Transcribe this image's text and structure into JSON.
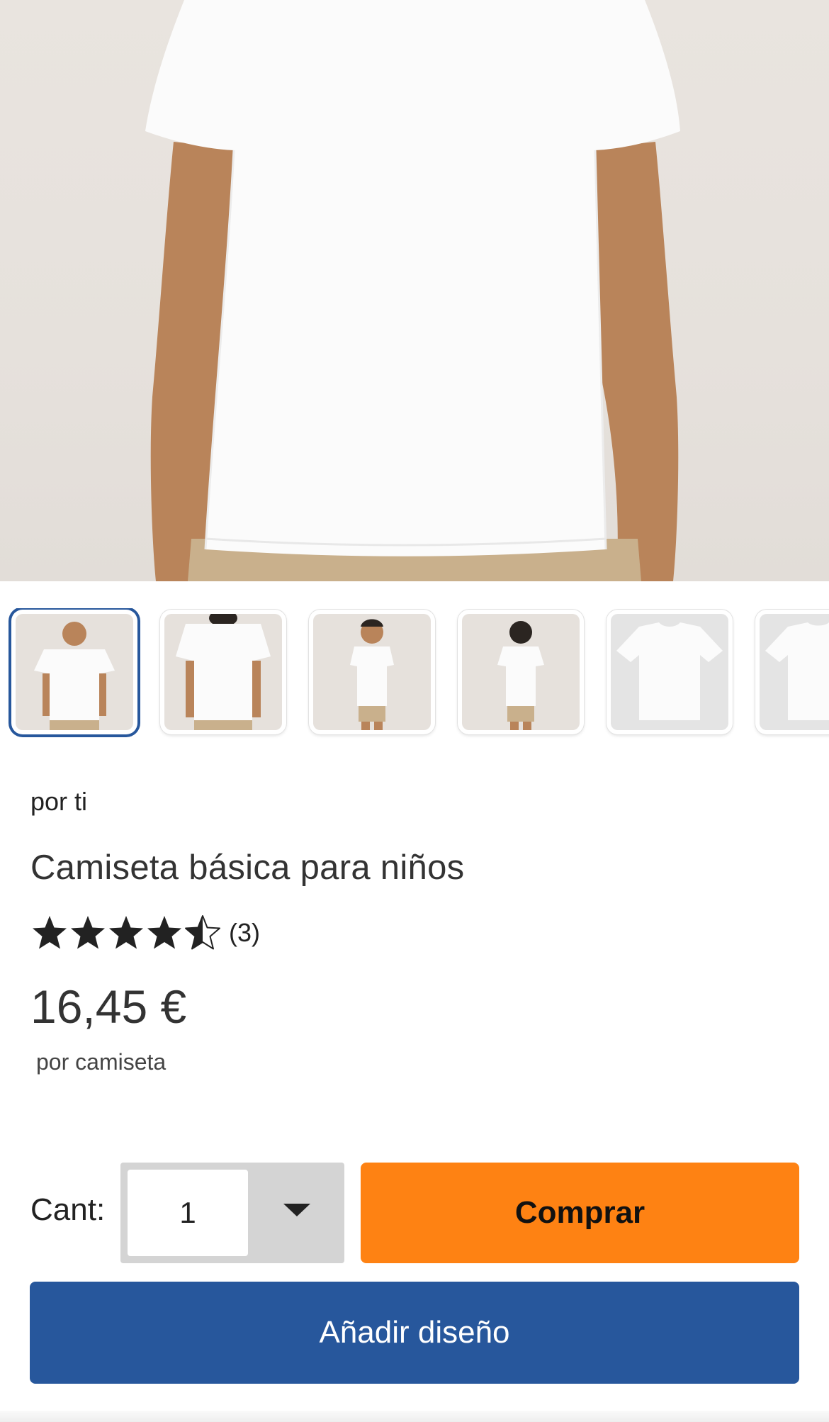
{
  "product": {
    "brand": "por ti",
    "title": "Camiseta básica para niños",
    "rating_value": 4.5,
    "rating_max": 5,
    "rating_count": "(3)",
    "price": "16,45 €",
    "unit": "por camiseta"
  },
  "gallery": {
    "selected_index": 0,
    "thumbnail_count_visible": 6
  },
  "purchase": {
    "qty_label": "Cant:",
    "qty_value": "1",
    "buy_label": "Comprar",
    "add_design_label": "Añadir diseño"
  },
  "colors": {
    "buy_button": "#fe8213",
    "add_design_button": "#27579c",
    "selected_thumbnail_border": "#27579c",
    "star_color": "#222222"
  }
}
